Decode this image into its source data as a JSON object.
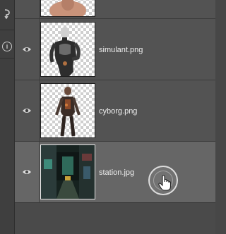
{
  "toolbar": {
    "icons": [
      "history-brush-icon",
      "info-icon"
    ],
    "info_glyph": "i"
  },
  "layers": [
    {
      "name": "",
      "visible": true
    },
    {
      "name": "simulant.png",
      "visible": true
    },
    {
      "name": "cyborg.png",
      "visible": true
    },
    {
      "name": "station.jpg",
      "visible": true,
      "selected": true
    }
  ],
  "colors": {
    "panel": "#535353",
    "selected_row": "#666666",
    "text": "#eeeeee"
  }
}
